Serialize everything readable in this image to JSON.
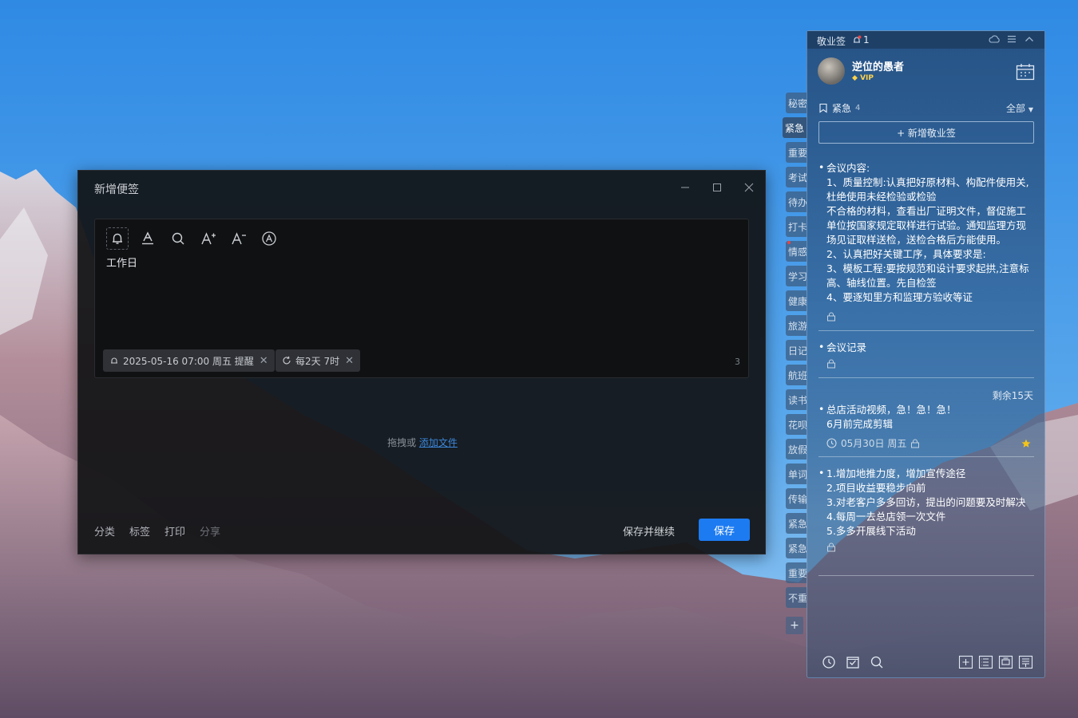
{
  "dialog": {
    "title": "新增便签",
    "editor_text": "工作日",
    "reminder_chip": "2025-05-16 07:00 周五 提醒",
    "repeat_chip": "每2天 7时",
    "char_count": "3",
    "drop_text": "拖拽或",
    "drop_link": "添加文件",
    "footer_actions": [
      "分类",
      "标签",
      "打印",
      "分享"
    ],
    "save_continue": "保存并继续",
    "save": "保存"
  },
  "tabs": [
    "秘密",
    "紧急",
    "重要",
    "考试",
    "待办",
    "打卡",
    "情感",
    "学习",
    "健康",
    "旅游",
    "日记",
    "航班",
    "读书",
    "花呗",
    "放假",
    "单词",
    "传输",
    "紧急",
    "紧急",
    "重要",
    "不重"
  ],
  "panel": {
    "app_name": "敬业签",
    "reminder_count": "1",
    "username": "逆位的愚者",
    "vip": "VIP",
    "section": "紧急",
    "section_count": "4",
    "filter": "全部",
    "add_button": "+ 新增敬业签",
    "notes": [
      {
        "text": "会议内容:\n1、质量控制:认真把好原材料、构配件使用关,杜绝使用未经检验或检验\n不合格的材料，查看出厂证明文件，督促施工单位按国家规定取样进行试验。通知监理方现场见证取样送检，送检合格后方能使用。\n2、认真把好关键工序，具体要求是:\n3、模板工程:要按规范和设计要求起拱,注意标高、轴线位置。先自检签\n4、要逐知里方和监理方验收等证"
      },
      {
        "text": "会议记录"
      },
      {
        "text": "总店活动视频，急！急！急！\n6月前完成剪辑",
        "remaining": "剩余15天",
        "date": "05月30日 周五"
      },
      {
        "text": "1.增加地推力度，增加宣传途径\n2.项目收益要稳步向前\n3.对老客户多多回访，提出的问题要及时解决\n4.每周一去总店领一次文件\n5.多多开展线下活动"
      }
    ]
  },
  "icons": {
    "bell": "bell-icon",
    "font": "font-color-icon",
    "search": "search-icon",
    "font_up": "font-increase-icon",
    "font_down": "font-decrease-icon",
    "ai": "ai-icon",
    "repeat": "repeat-icon",
    "star_color": "#f5c518",
    "save_color": "#1d7bf2"
  }
}
